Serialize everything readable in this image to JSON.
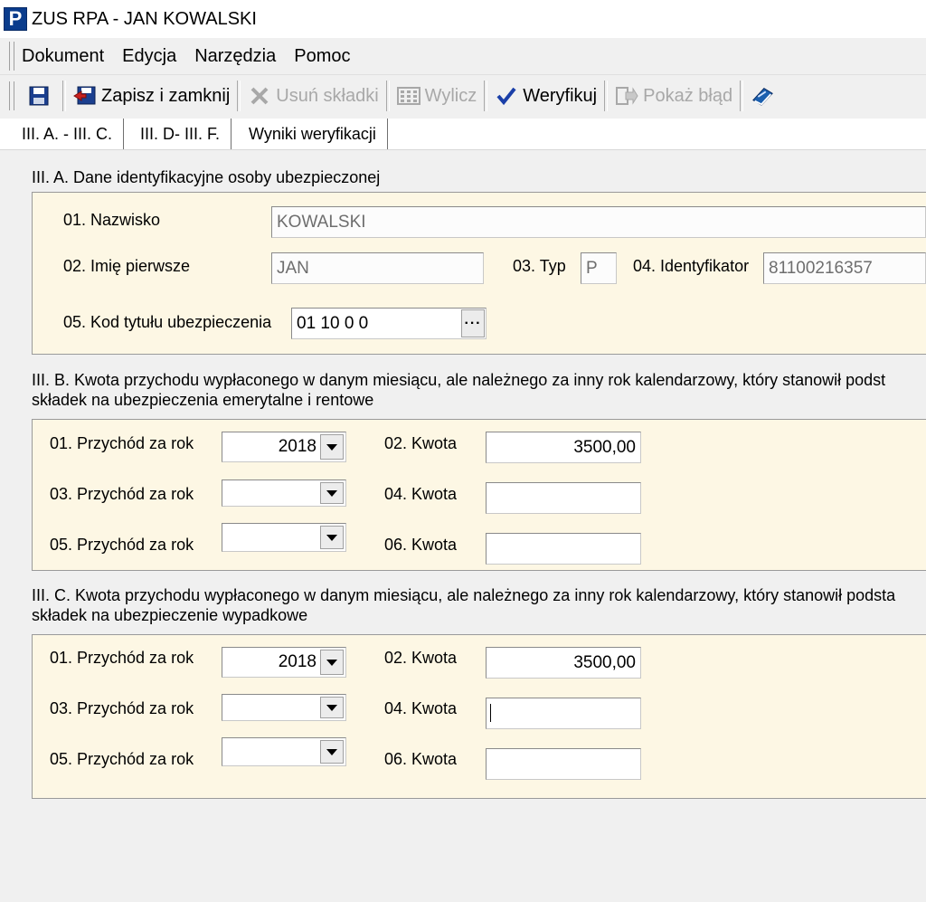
{
  "window": {
    "title": "ZUS RPA - JAN KOWALSKI",
    "icon_letter": "P"
  },
  "menu": {
    "items": [
      "Dokument",
      "Edycja",
      "Narzędzia",
      "Pomoc"
    ]
  },
  "toolbar": {
    "zapisz": "Zapisz i zamknij",
    "usun": "Usuń składki",
    "wylicz": "Wylicz",
    "weryfikuj": "Weryfikuj",
    "pokaz": "Pokaż błąd"
  },
  "tabs": [
    "III. A. - III. C.",
    "III. D- III. F.",
    "Wyniki weryfikacji"
  ],
  "sectionA": {
    "title": "III. A. Dane identyfikacyjne osoby ubezpieczonej",
    "l01": "01. Nazwisko",
    "v01": "KOWALSKI",
    "l02": "02. Imię pierwsze",
    "v02": "JAN",
    "l03": "03. Typ",
    "v03": "P",
    "l04": "04. Identyfikator",
    "v04": "81100216357",
    "l05": "05. Kod tytułu ubezpieczenia",
    "v05": "01 10 0 0"
  },
  "sectionB": {
    "title1": "III. B. Kwota przychodu wypłaconego w danym miesiącu, ale należnego za inny rok kalendarzowy, który  stanowił podst",
    "title2": "składek na ubezpieczenia emerytalne i rentowe",
    "l01": "01. Przychód za  rok",
    "v01": "2018",
    "l02": "02. Kwota",
    "v02": "3500,00",
    "l03": "03. Przychód za  rok",
    "v03": "",
    "l04": "04. Kwota",
    "v04": "",
    "l05": "05. Przychód za  rok",
    "v05": "",
    "l06": "06. Kwota",
    "v06": ""
  },
  "sectionC": {
    "title1": "III. C. Kwota przychodu wypłaconego w danym miesiącu, ale należnego za inny rok kalendarzowy, który stanowił podsta",
    "title2": "składek na ubezpieczenie wypadkowe",
    "l01": "01. Przychód za  rok",
    "v01": "2018",
    "l02": "02. Kwota",
    "v02": "3500,00",
    "l03": "03. Przychód za  rok",
    "v03": "",
    "l04": "04. Kwota",
    "v04": "",
    "l05": "05. Przychód za  rok",
    "v05": "",
    "l06": "06. Kwota",
    "v06": ""
  },
  "colors": {
    "panel_bg": "#fdf7e4",
    "icon_blue": "#0a3c8c",
    "check_blue": "#1a3fa8"
  },
  "icons": [
    "app-icon",
    "save-icon",
    "save-close-icon",
    "delete-icon",
    "calculator-icon",
    "check-icon",
    "show-error-icon",
    "help-book-icon"
  ]
}
